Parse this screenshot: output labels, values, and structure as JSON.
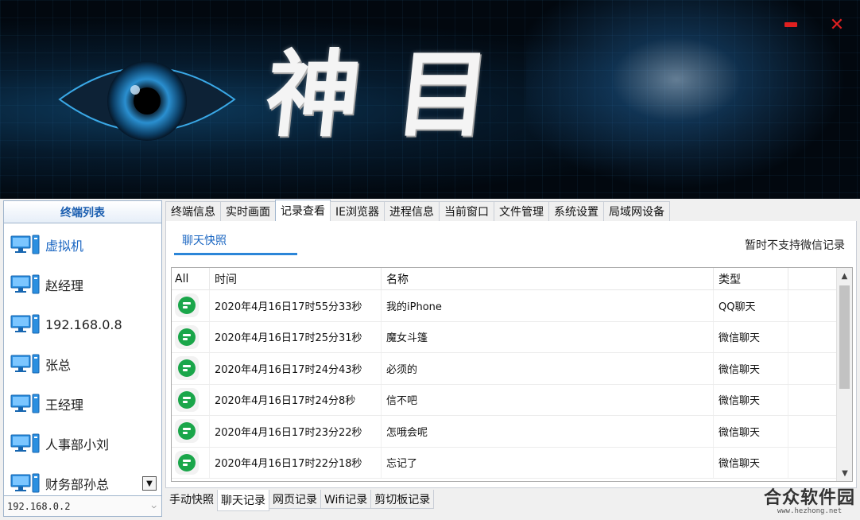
{
  "window": {
    "title_glyphs": [
      "神",
      "目"
    ],
    "minimize_icon": "minimize-icon",
    "close_icon": "close-icon",
    "accent_red": "#e02020"
  },
  "sidebar": {
    "header": "终端列表",
    "devices": [
      {
        "label": "虚拟机",
        "icon": "computer-icon",
        "active": true
      },
      {
        "label": "赵经理",
        "icon": "computer-icon"
      },
      {
        "label": "192.168.0.8",
        "icon": "computer-icon"
      },
      {
        "label": "张总",
        "icon": "computer-icon"
      },
      {
        "label": "王经理",
        "icon": "computer-icon"
      },
      {
        "label": "人事部小刘",
        "icon": "computer-icon"
      },
      {
        "label": "财务部孙总",
        "icon": "computer-icon"
      }
    ],
    "selected_ip": "192.168.0.2"
  },
  "main_tabs": [
    "终端信息",
    "实时画面",
    "记录查看",
    "IE浏览器",
    "进程信息",
    "当前窗口",
    "文件管理",
    "系统设置",
    "局域网设备"
  ],
  "active_main_tab": "记录查看",
  "panel": {
    "subtab": "聊天快照",
    "notice": "暂时不支持微信记录",
    "columns": [
      "All",
      "时间",
      "名称",
      "类型",
      ""
    ],
    "rows": [
      {
        "time": "2020年4月16日17时55分33秒",
        "name": "我的iPhone",
        "type": "QQ聊天"
      },
      {
        "time": "2020年4月16日17时25分31秒",
        "name": "魔女斗篷",
        "type": "微信聊天"
      },
      {
        "time": "2020年4月16日17时24分43秒",
        "name": "必须的",
        "type": "微信聊天"
      },
      {
        "time": "2020年4月16日17时24分8秒",
        "name": "信不吧",
        "type": "微信聊天"
      },
      {
        "time": "2020年4月16日17时23分22秒",
        "name": "怎哦会呢",
        "type": "微信聊天"
      },
      {
        "time": "2020年4月16日17时22分18秒",
        "name": "忘记了",
        "type": "微信聊天"
      }
    ],
    "row_icon": "chat-bubble-icon",
    "row_icon_color": "#1aa64a"
  },
  "bottom_tabs": [
    "手动快照",
    "聊天记录",
    "网页记录",
    "Wifi记录",
    "剪切板记录"
  ],
  "active_bottom_tab": "聊天记录",
  "watermark": {
    "text": "合众软件园",
    "url": "www.hezhong.net"
  }
}
